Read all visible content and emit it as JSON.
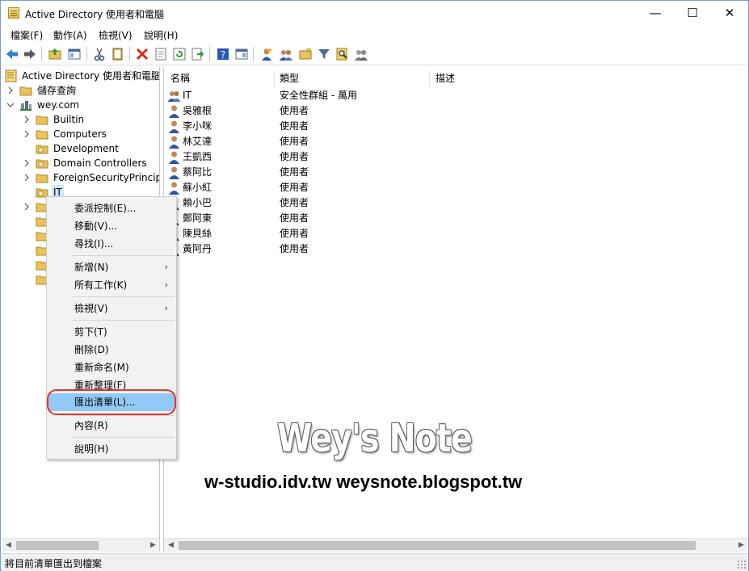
{
  "window": {
    "title": "Active Directory 使用者和電腦",
    "minimize_glyph": "—",
    "maximize_glyph": "☐",
    "close_glyph": "✕"
  },
  "menubar": {
    "items": [
      "檔案(F)",
      "動作(A)",
      "檢視(V)",
      "說明(H)"
    ]
  },
  "toolbar": {
    "icons": [
      "back-arrow-icon",
      "forward-arrow-icon",
      "up-folder-icon",
      "show-hide-tree-icon",
      "cut-icon",
      "copy-icon",
      "delete-icon",
      "properties-icon",
      "refresh-icon",
      "export-list-icon",
      "help-icon",
      "console-icon",
      "new-user-icon",
      "new-group-icon",
      "new-ou-icon",
      "filter-icon",
      "find-icon",
      "add-to-group-icon"
    ]
  },
  "tree": {
    "root": "Active Directory 使用者和電腦 [",
    "items": [
      {
        "label": "儲存查詢",
        "icon": "folder-icon"
      },
      {
        "label": "wey.com",
        "icon": "domain-icon"
      },
      {
        "label": "Builtin",
        "icon": "folder-icon"
      },
      {
        "label": "Computers",
        "icon": "folder-icon"
      },
      {
        "label": "Development",
        "icon": "ou-folder-icon"
      },
      {
        "label": "Domain Controllers",
        "icon": "ou-folder-icon"
      },
      {
        "label": "ForeignSecurityPrincipals",
        "icon": "folder-icon"
      },
      {
        "label": "IT",
        "icon": "ou-folder-icon"
      }
    ]
  },
  "list": {
    "columns": [
      "名稱",
      "類型",
      "描述"
    ],
    "rows": [
      {
        "name": "IT",
        "type": "安全性群組 - 萬用",
        "icon": "group-icon"
      },
      {
        "name": "吳雅根",
        "type": "使用者",
        "icon": "user-icon"
      },
      {
        "name": "李小咪",
        "type": "使用者",
        "icon": "user-icon"
      },
      {
        "name": "林艾達",
        "type": "使用者",
        "icon": "user-icon"
      },
      {
        "name": "王凱西",
        "type": "使用者",
        "icon": "user-icon"
      },
      {
        "name": "蔡阿比",
        "type": "使用者",
        "icon": "user-icon"
      },
      {
        "name": "蘇小紅",
        "type": "使用者",
        "icon": "user-icon"
      },
      {
        "name": "賴小巴",
        "type": "使用者",
        "icon": "user-icon"
      },
      {
        "name": "鄭阿東",
        "type": "使用者",
        "icon": "user-icon"
      },
      {
        "name": "陳貝絲",
        "type": "使用者",
        "icon": "user-icon"
      },
      {
        "name": "黃阿丹",
        "type": "使用者",
        "icon": "user-icon"
      }
    ]
  },
  "context_menu": {
    "items": [
      {
        "label": "委派控制(E)..."
      },
      {
        "label": "移動(V)..."
      },
      {
        "label": "尋找(I)..."
      },
      {
        "label": "新增(N)",
        "submenu": true
      },
      {
        "label": "所有工作(K)",
        "submenu": true
      },
      {
        "label": "檢視(V)",
        "submenu": true
      },
      {
        "label": "剪下(T)"
      },
      {
        "label": "刪除(D)"
      },
      {
        "label": "重新命名(M)"
      },
      {
        "label": "重新整理(F)"
      },
      {
        "label": "匯出清單(L)...",
        "highlighted": true
      },
      {
        "label": "內容(R)"
      },
      {
        "label": "說明(H)"
      }
    ],
    "submenu_glyph": "›"
  },
  "statusbar": {
    "text": "將目前清單匯出到檔案"
  },
  "scroll": {
    "left_glyph": "◀",
    "right_glyph": "▶"
  },
  "watermark": {
    "title": "Wey's Note",
    "urls": "w-studio.idv.tw  weysnote.blogspot.tw"
  },
  "colors": {
    "highlight": "#91c9f7",
    "ring": "#e8342c",
    "selected": "#cce8ff"
  }
}
